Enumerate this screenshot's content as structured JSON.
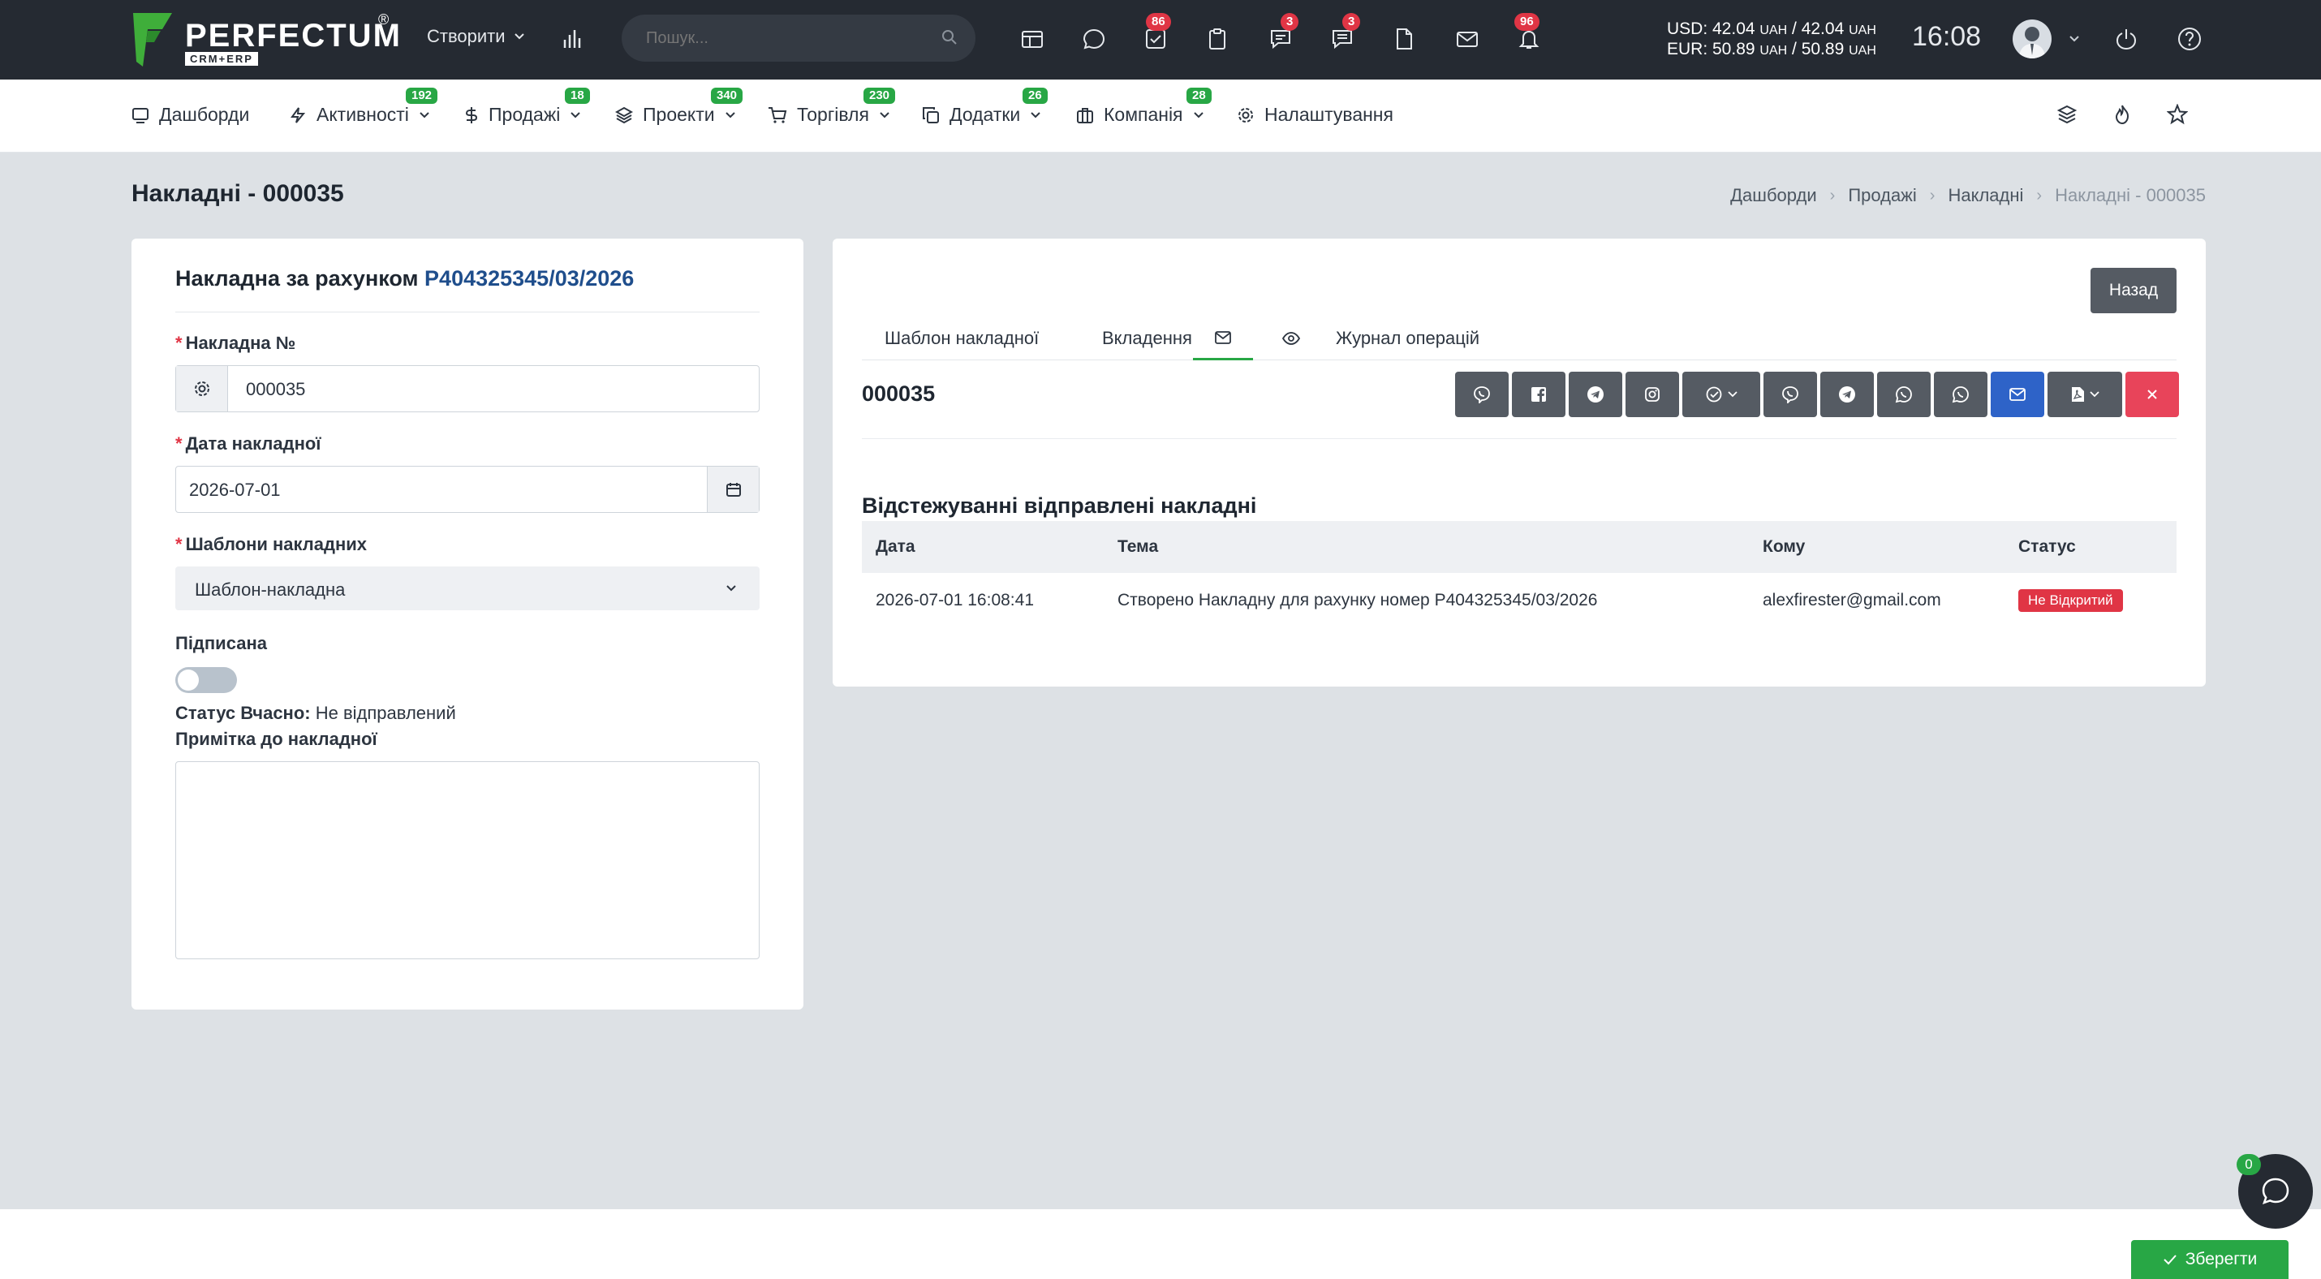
{
  "brand": {
    "name": "PERFECTUM",
    "reg": "®",
    "sub": "CRM+ERP"
  },
  "topbar": {
    "create_label": "Створити",
    "search_placeholder": "Пошук...",
    "badges": {
      "tasks": "86",
      "chats": "3",
      "comments": "3",
      "notifications": "96"
    },
    "rates": {
      "usd_prefix": "USD: 42.04",
      "usd_unit1": "UAH",
      "usd_mid": " / 42.04",
      "usd_unit2": "UAH",
      "eur_prefix": "EUR: 50.89",
      "eur_unit1": "UAH",
      "eur_mid": " / 50.89",
      "eur_unit2": "UAH"
    },
    "time": "16:08"
  },
  "nav": [
    {
      "label": "Дашборди",
      "badge": ""
    },
    {
      "label": "Активності",
      "badge": "192"
    },
    {
      "label": "Продажі",
      "badge": "18"
    },
    {
      "label": "Проекти",
      "badge": "340"
    },
    {
      "label": "Торгівля",
      "badge": "230"
    },
    {
      "label": "Додатки",
      "badge": "26"
    },
    {
      "label": "Компанія",
      "badge": "28"
    },
    {
      "label": "Налаштування",
      "badge": ""
    }
  ],
  "page": {
    "title": "Накладні - 000035",
    "breadcrumb": [
      "Дашборди",
      "Продажі",
      "Накладні",
      "Накладні - 000035"
    ]
  },
  "form": {
    "title": "Накладна за рахунком",
    "invoice_link": "P404325345/03/2026",
    "number_label": "Накладна №",
    "number_value": "000035",
    "date_label": "Дата накладної",
    "date_value": "2026-07-01",
    "template_label": "Шаблони накладних",
    "template_value": "Шаблон-накладна",
    "signed_label": "Підписана",
    "status_label": "Статус Вчасно:",
    "status_value": "Не відправлений",
    "note_label": "Примітка до накладної",
    "note_value": ""
  },
  "panel": {
    "back_label": "Назад",
    "tabs": [
      "Шаблон накладної",
      "Вкладення",
      "Журнал операцій"
    ],
    "doc_number": "000035",
    "tracking_title": "Відстежуванні відправлені накладні",
    "columns": [
      "Дата",
      "Тема",
      "Кому",
      "Статус"
    ],
    "rows": [
      {
        "date": "2026-07-01 16:08:41",
        "subject": "Створено Накладну для рахунку номер  P404325345/03/2026",
        "to": "alexfirester@gmail.com",
        "status": "Не Відкритий"
      }
    ]
  },
  "footer": {
    "save_label": "Зберегти",
    "chat_count": "0"
  },
  "colors": {
    "topbar": "#252a32",
    "accent": "#28a745",
    "danger": "#e03545",
    "link": "#1f4e8c",
    "mail_button": "#2e63c8"
  }
}
